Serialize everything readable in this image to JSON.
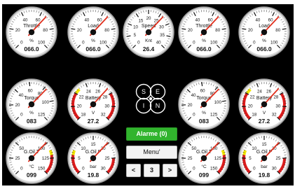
{
  "gauges": [
    {
      "name": "throttle-gauge",
      "label": "Throttle",
      "unit": "%",
      "ticks": [
        "0",
        "20",
        "40",
        "60",
        "80",
        "100"
      ],
      "ticks_labeled": [
        0,
        20,
        40,
        60,
        80,
        100
      ],
      "min": 0,
      "max": 100,
      "value": 66,
      "readout": "066.0",
      "red_from": null
    },
    {
      "name": "load-gauge",
      "label": "Load",
      "unit": "%",
      "ticks": [
        "0",
        "20",
        "40",
        "60",
        "80",
        "100"
      ],
      "ticks_labeled": [
        0,
        20,
        40,
        60,
        80,
        100
      ],
      "min": 0,
      "max": 100,
      "value": 66,
      "readout": "066.0",
      "red_from": null
    },
    {
      "name": "speed-gauge",
      "label": "Speed",
      "unit": "Knt",
      "ticks": [
        "0",
        "5",
        "10",
        "15",
        "20",
        "25",
        "30",
        "35",
        "40"
      ],
      "ticks_labeled": [
        0,
        5,
        10,
        15,
        20,
        25,
        30,
        35,
        40
      ],
      "min": 0,
      "max": 40,
      "value": 26.4,
      "readout": "26.4",
      "red_from": null
    },
    {
      "name": "throttle-gauge-2",
      "label": "Throttle",
      "unit": "%",
      "ticks": [
        "0",
        "20",
        "40",
        "60",
        "80",
        "100"
      ],
      "ticks_labeled": [
        0,
        20,
        40,
        60,
        80,
        100
      ],
      "min": 0,
      "max": 100,
      "value": 66,
      "readout": "066.0",
      "red_from": null
    },
    {
      "name": "load-gauge-2",
      "label": "Load",
      "unit": "%",
      "ticks": [
        "0",
        "20",
        "40",
        "60",
        "80",
        "100"
      ],
      "ticks_labeled": [
        0,
        20,
        40,
        60,
        80,
        100
      ],
      "min": 0,
      "max": 100,
      "value": 66,
      "readout": "066.0",
      "red_from": null
    },
    {
      "name": "torque-gauge",
      "label": "Torque",
      "unit": "%",
      "ticks": [
        "0",
        "20",
        "40",
        "60",
        "80",
        "100",
        "125"
      ],
      "ticks_labeled": [
        0,
        20,
        40,
        60,
        80,
        100,
        125
      ],
      "min": 0,
      "max": 125,
      "value": 83,
      "readout": "083",
      "red_from": null
    },
    {
      "name": "battery-gauge",
      "label": "Battery",
      "unit": "V",
      "ticks": [
        "18",
        "20",
        "22",
        "24",
        "26",
        "28",
        "30",
        "32"
      ],
      "ticks_labeled": [
        18,
        20,
        22,
        24,
        26,
        28,
        30,
        32
      ],
      "min": 18,
      "max": 32,
      "value": 27.2,
      "readout": "27.2",
      "red_bands": [
        [
          18,
          22
        ],
        [
          28,
          32
        ]
      ],
      "yellow_bands": [
        [
          22,
          22.8
        ]
      ]
    },
    {
      "name": "torque-gauge-2",
      "label": "Torque",
      "unit": "%",
      "ticks": [
        "0",
        "20",
        "40",
        "60",
        "80",
        "100",
        "125"
      ],
      "ticks_labeled": [
        0,
        20,
        40,
        60,
        80,
        100,
        125
      ],
      "min": 0,
      "max": 125,
      "value": 83,
      "readout": "083",
      "red_from": null
    },
    {
      "name": "battery-gauge-2",
      "label": "Battery",
      "unit": "V",
      "ticks": [
        "18",
        "20",
        "22",
        "24",
        "26",
        "28",
        "30",
        "32"
      ],
      "ticks_labeled": [
        18,
        20,
        22,
        24,
        26,
        28,
        30,
        32
      ],
      "min": 18,
      "max": 32,
      "value": 27.2,
      "readout": "27.2",
      "red_bands": [
        [
          18,
          22
        ],
        [
          28,
          32
        ]
      ],
      "yellow_bands": [
        [
          22,
          22.8
        ]
      ]
    },
    {
      "name": "gear-oil-temp-gauge",
      "label": "G.Oil T",
      "unit": "°C",
      "ticks": [
        "0",
        "25",
        "50",
        "100",
        "125",
        "150"
      ],
      "ticks_labeled": [
        0,
        25,
        50,
        100,
        125,
        150
      ],
      "min": 0,
      "max": 150,
      "value": 99,
      "readout": "099",
      "red_bands": [
        [
          120,
          150
        ]
      ],
      "yellow_bands": [
        [
          112,
          120
        ]
      ]
    },
    {
      "name": "gear-oil-pressure-gauge",
      "label": "G.Oil P",
      "unit": "bar",
      "ticks": [
        "0",
        "5",
        "10",
        "15",
        "20",
        "25",
        "30"
      ],
      "ticks_labeled": [
        0,
        5,
        10,
        15,
        20,
        25,
        30
      ],
      "min": 0,
      "max": 30,
      "value": 19.8,
      "readout": "19.8",
      "red_bands": [
        [
          0,
          6
        ],
        [
          25,
          30
        ]
      ],
      "yellow_bands": [
        [
          6,
          7.5
        ]
      ]
    },
    {
      "name": "gear-oil-temp-gauge-2",
      "label": "G.Oil T",
      "unit": "°C",
      "ticks": [
        "0",
        "25",
        "50",
        "100",
        "125",
        "150"
      ],
      "ticks_labeled": [
        0,
        25,
        50,
        100,
        125,
        150
      ],
      "min": 0,
      "max": 150,
      "value": 99,
      "readout": "099",
      "red_bands": [
        [
          120,
          150
        ]
      ],
      "yellow_bands": [
        [
          112,
          120
        ]
      ]
    },
    {
      "name": "gear-oil-pressure-gauge-2",
      "label": "G.Oil P",
      "unit": "bar",
      "ticks": [
        "0",
        "5",
        "10",
        "15",
        "20",
        "25",
        "30"
      ],
      "ticks_labeled": [
        0,
        5,
        10,
        15,
        20,
        25,
        30
      ],
      "min": 0,
      "max": 30,
      "value": 19.8,
      "readout": "19.8",
      "red_bands": [
        [
          0,
          6
        ],
        [
          25,
          30
        ]
      ],
      "yellow_bands": [
        [
          6,
          7.5
        ]
      ]
    }
  ],
  "controls": {
    "alarm_label": "Alarme (0)",
    "menu_label": "Menu'",
    "prev_label": "<",
    "page_number": "3",
    "next_label": ">"
  },
  "logo": {
    "letters": [
      "S",
      "E",
      "I",
      "N"
    ],
    "icon": "four-circle-logo-icon"
  },
  "colors": {
    "alarm_green": "#31b42d",
    "red_band": "#e01b1b",
    "yellow_band": "#f2e600",
    "needle": "#e0301e",
    "panel": "#000000"
  }
}
